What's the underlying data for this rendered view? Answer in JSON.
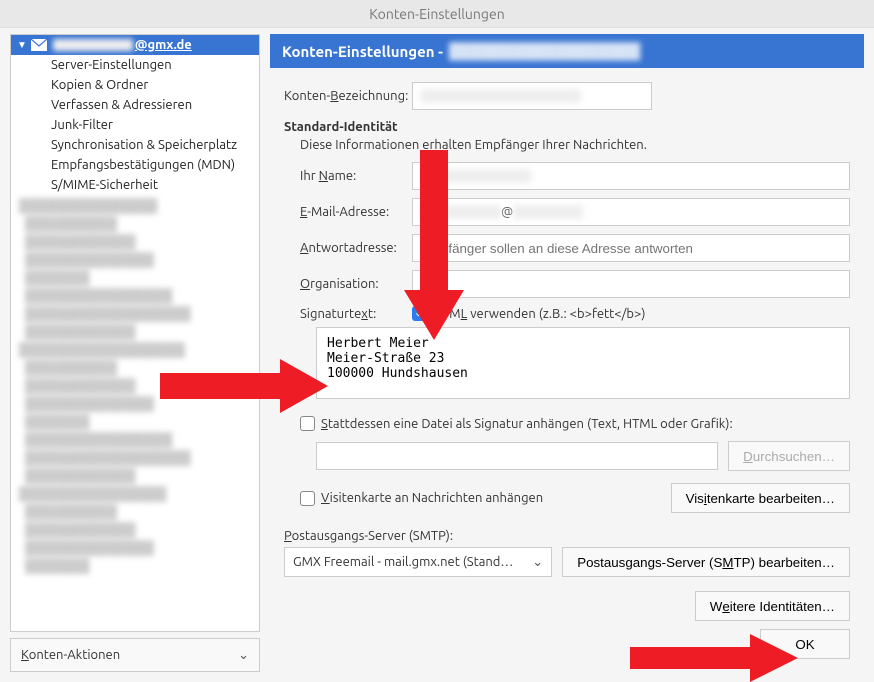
{
  "window_title": "Konten-Einstellungen",
  "sidebar": {
    "account_email": "@gmx.de",
    "items": [
      "Server-Einstellungen",
      "Kopien & Ordner",
      "Verfassen & Adressieren",
      "Junk-Filter",
      "Synchronisation & Speicherplatz",
      "Empfangsbestätigungen (MDN)",
      "S/MIME-Sicherheit"
    ],
    "actions_label": "Konten-Aktionen"
  },
  "main": {
    "header_prefix": "Konten-Einstellungen - ",
    "account_label": "Konten-Bezeichnung:",
    "account_value_blurred": "████████████",
    "identity_heading": "Standard-Identität",
    "identity_sub": "Diese Informationen erhalten Empfänger Ihrer Nachrichten.",
    "name_label": "Ihr Name:",
    "name_value_blurred": "███████████",
    "email_label": "E-Mail-Adresse:",
    "email_value_blurred": "██████████@█████████",
    "reply_label": "Antwortadresse:",
    "reply_placeholder": "Empfänger sollen an diese Adresse antworten",
    "org_label": "Organisation:",
    "sig_label": "Signaturtext:",
    "html_check_label": "HTML verwenden (z.B.: <b>fett</b>)",
    "signature_text": "Herbert Meier\nMeier-Straße 23\n100000 Hundshausen",
    "file_check_label": "Stattdessen eine Datei als Signatur anhängen (Text, HTML oder Grafik):",
    "browse_label": "Durchsuchen…",
    "vcard_check_label": "Visitenkarte an Nachrichten anhängen",
    "vcard_edit_label": "Visitenkarte bearbeiten…",
    "smtp_label": "Postausgangs-Server (SMTP):",
    "smtp_value": "GMX Freemail - mail.gmx.net (Stand…",
    "smtp_edit_label": "Postausgangs-Server (SMTP) bearbeiten…",
    "more_identities_label": "Weitere Identitäten…",
    "ok_label": "OK"
  }
}
